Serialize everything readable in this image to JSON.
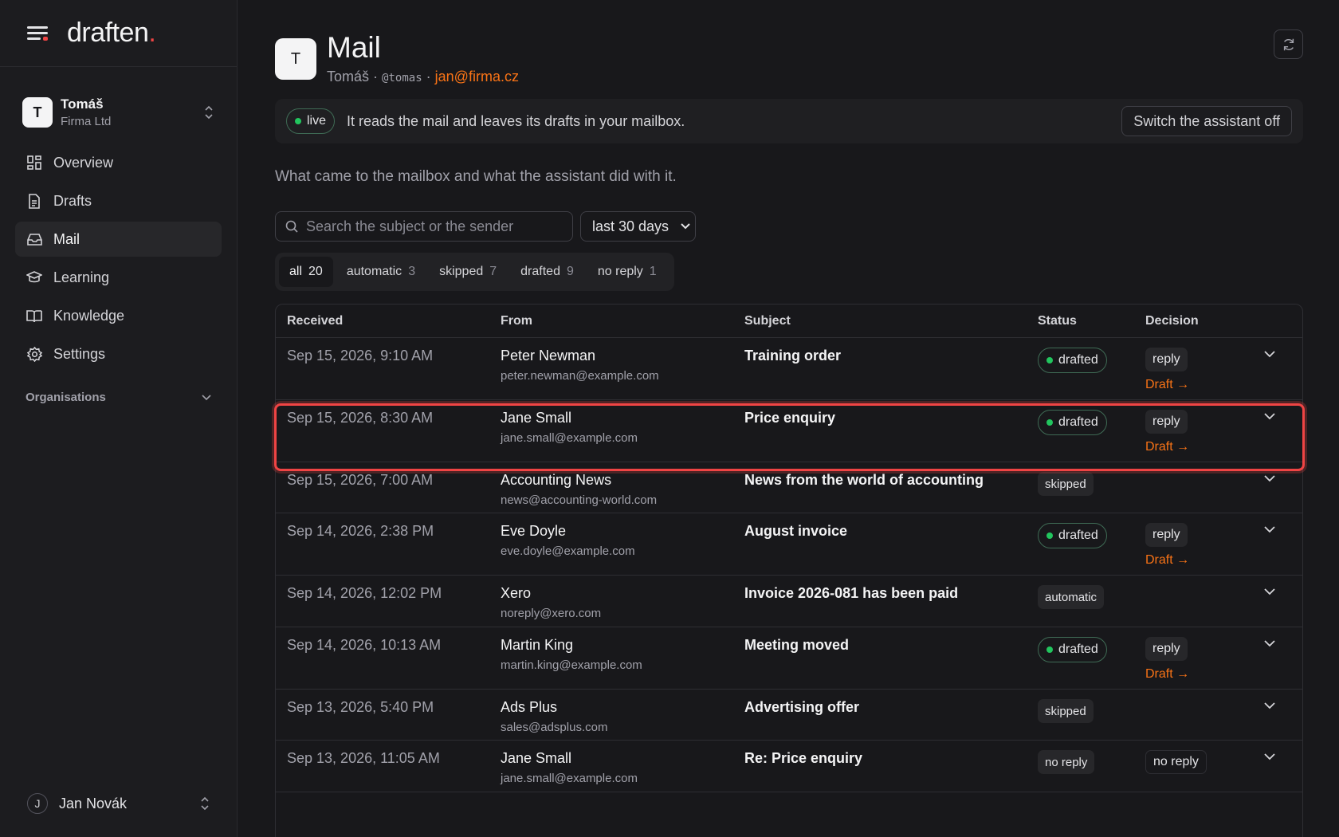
{
  "brand": {
    "name": "draften",
    "dot": "."
  },
  "org": {
    "initial": "T",
    "name": "Tomáš",
    "company": "Firma Ltd"
  },
  "nav": [
    {
      "label": "Overview",
      "icon": "grid-icon"
    },
    {
      "label": "Drafts",
      "icon": "document-icon"
    },
    {
      "label": "Mail",
      "icon": "inbox-icon",
      "active": true
    },
    {
      "label": "Learning",
      "icon": "graduation-cap-icon"
    },
    {
      "label": "Knowledge",
      "icon": "book-icon"
    },
    {
      "label": "Settings",
      "icon": "gear-icon"
    }
  ],
  "organisations_label": "Organisations",
  "user": {
    "initial": "J",
    "name": "Jan Novák"
  },
  "page": {
    "initial": "T",
    "title": "Mail",
    "sub_name": "Tomáš",
    "sub_handle": "@tomas",
    "sub_email": "jan@firma.cz",
    "sep": "·"
  },
  "live": {
    "status": "live",
    "text": "It reads the mail and leaves its drafts in your mailbox.",
    "switch_off": "Switch the assistant off"
  },
  "description": "What came to the mailbox and what the assistant did with it.",
  "search": {
    "placeholder": "Search the subject or the sender"
  },
  "range": {
    "value": "last 30 days"
  },
  "filters": [
    {
      "label": "all",
      "count": "20",
      "active": true
    },
    {
      "label": "automatic",
      "count": "3"
    },
    {
      "label": "skipped",
      "count": "7"
    },
    {
      "label": "drafted",
      "count": "9"
    },
    {
      "label": "no reply",
      "count": "1"
    }
  ],
  "columns": {
    "received": "Received",
    "from": "From",
    "subject": "Subject",
    "status": "Status",
    "decision": "Decision"
  },
  "rows": [
    {
      "received": "Sep 15, 2026, 9:10 AM",
      "name": "Peter Newman",
      "email": "peter.newman@example.com",
      "subject": "Training order",
      "status": "drafted",
      "decision": "reply",
      "draft": "Draft →"
    },
    {
      "received": "Sep 15, 2026, 8:30 AM",
      "name": "Jane Small",
      "email": "jane.small@example.com",
      "subject": "Price enquiry",
      "status": "drafted",
      "decision": "reply",
      "draft": "Draft →"
    },
    {
      "received": "Sep 15, 2026, 7:00 AM",
      "name": "Accounting News",
      "email": "news@accounting-world.com",
      "subject": "News from the world of accounting",
      "status": "skipped",
      "decision": "",
      "draft": ""
    },
    {
      "received": "Sep 14, 2026, 2:38 PM",
      "name": "Eve Doyle",
      "email": "eve.doyle@example.com",
      "subject": "August invoice",
      "status": "drafted",
      "decision": "reply",
      "draft": "Draft →"
    },
    {
      "received": "Sep 14, 2026, 12:02 PM",
      "name": "Xero",
      "email": "noreply@xero.com",
      "subject": "Invoice 2026-081 has been paid",
      "status": "automatic",
      "decision": "",
      "draft": ""
    },
    {
      "received": "Sep 14, 2026, 10:13 AM",
      "name": "Martin King",
      "email": "martin.king@example.com",
      "subject": "Meeting moved",
      "status": "drafted",
      "decision": "reply",
      "draft": "Draft →"
    },
    {
      "received": "Sep 13, 2026, 5:40 PM",
      "name": "Ads Plus",
      "email": "sales@adsplus.com",
      "subject": "Advertising offer",
      "status": "skipped",
      "decision": "",
      "draft": ""
    },
    {
      "received": "Sep 13, 2026, 11:05 AM",
      "name": "Jane Small",
      "email": "jane.small@example.com",
      "subject": "Re: Price enquiry",
      "status": "no reply",
      "decision": "no reply",
      "draft": ""
    }
  ]
}
